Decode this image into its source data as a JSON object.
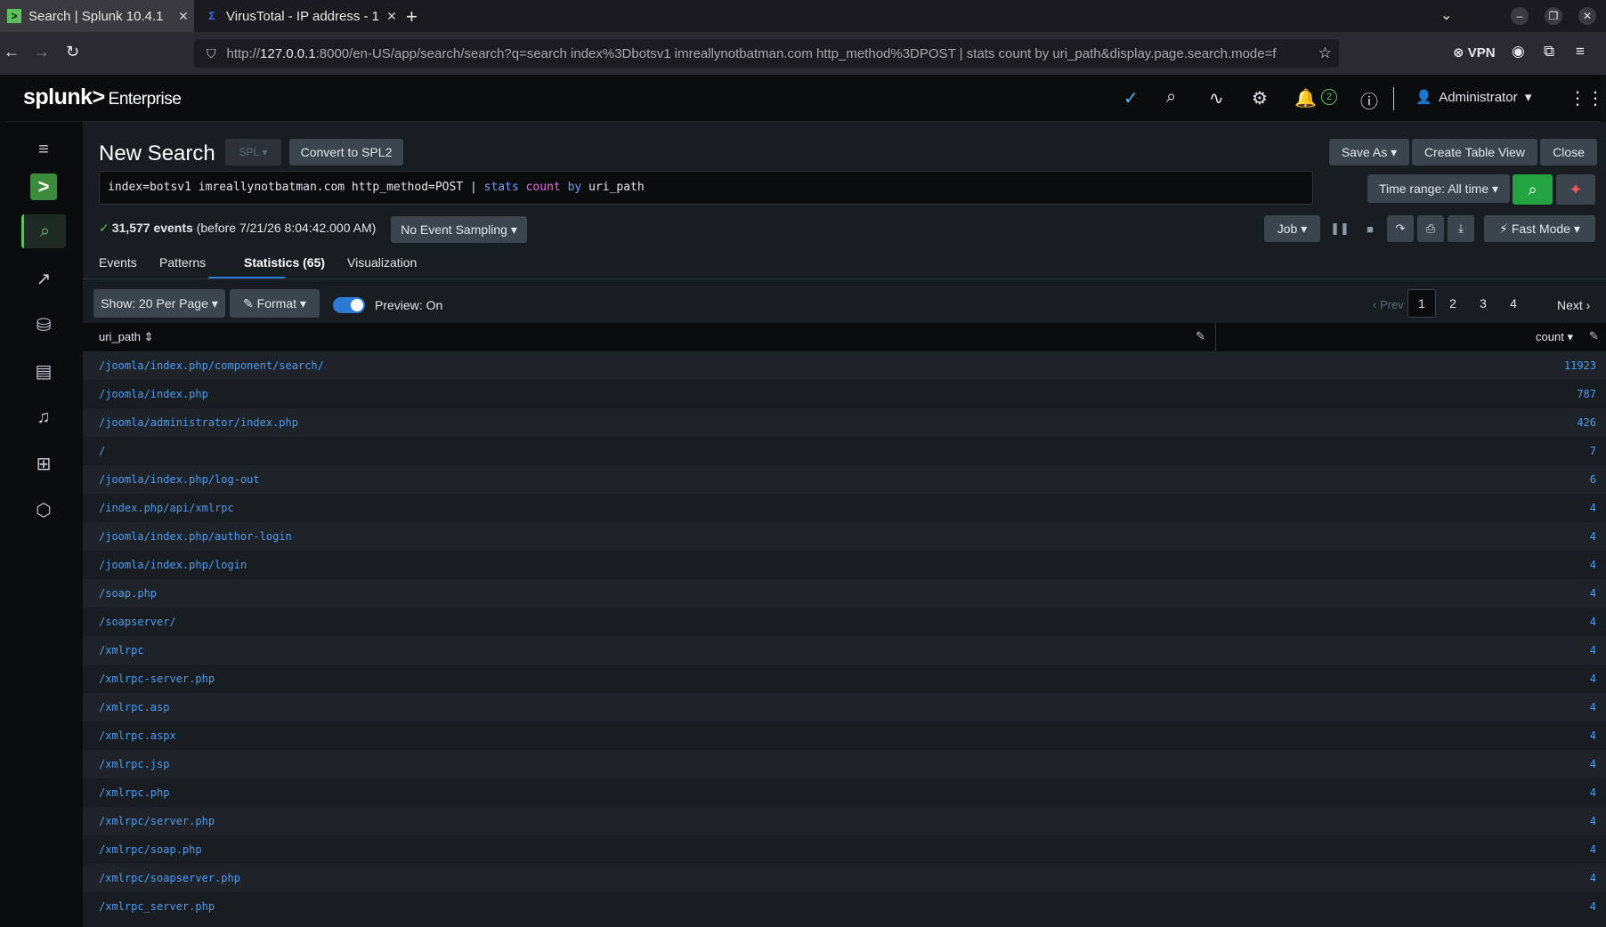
{
  "browser": {
    "tabs": [
      {
        "title": "Search | Splunk 10.4.1",
        "favicon": ">"
      },
      {
        "title": "VirusTotal - IP address - 1",
        "favicon": "Σ"
      }
    ],
    "url": {
      "prefix": "http://",
      "host": "127.0.0.1",
      "rest": ":8000/en-US/app/search/search?q=search index%3Dbotsv1 imreallynotbatman.com http_method%3DPOST | stats count by uri_path&display.page.search.mode=f"
    },
    "vpn_label": "VPN"
  },
  "splunk": {
    "logo": "splunk>",
    "product": "Enterprise",
    "notification_count": "2",
    "user": "Administrator"
  },
  "search": {
    "title": "New Search",
    "spl_label": "SPL",
    "convert_label": "Convert to SPL2",
    "save_as_label": "Save As",
    "create_table_view_label": "Create Table View",
    "close_label": "Close",
    "query_part1": "index=botsv1 imreallynotbatman.com http_method=POST | ",
    "query_cmd": "stats",
    "query_fn": "count",
    "query_by": "by",
    "query_field": "uri_path",
    "time_range_label": "Time range: All time",
    "event_count": "31,577 events",
    "event_suffix": "(before 7/21/26 8:04:42.000 AM)",
    "sampling_label": "No Event Sampling",
    "job_label": "Job",
    "mode_label": "Fast Mode"
  },
  "tabs": {
    "events": "Events",
    "patterns": "Patterns",
    "statistics": "Statistics (65)",
    "visualization": "Visualization"
  },
  "controls": {
    "per_page_label": "Show: 20 Per Page",
    "format_label": "Format",
    "preview_label": "Preview: On",
    "prev_label": "Prev",
    "next_label": "Next",
    "pages": [
      "1",
      "2",
      "3",
      "4"
    ],
    "current_page": "1"
  },
  "table": {
    "columns": [
      "uri_path",
      "count"
    ],
    "rows": [
      [
        "/joomla/index.php/component/search/",
        "11923"
      ],
      [
        "/joomla/index.php",
        "787"
      ],
      [
        "/joomla/administrator/index.php",
        "426"
      ],
      [
        "/",
        "7"
      ],
      [
        "/joomla/index.php/log-out",
        "6"
      ],
      [
        "/index.php/api/xmlrpc",
        "4"
      ],
      [
        "/joomla/index.php/author-login",
        "4"
      ],
      [
        "/joomla/index.php/login",
        "4"
      ],
      [
        "/soap.php",
        "4"
      ],
      [
        "/soapserver/",
        "4"
      ],
      [
        "/xmlrpc",
        "4"
      ],
      [
        "/xmlrpc-server.php",
        "4"
      ],
      [
        "/xmlrpc.asp",
        "4"
      ],
      [
        "/xmlrpc.aspx",
        "4"
      ],
      [
        "/xmlrpc.jsp",
        "4"
      ],
      [
        "/xmlrpc.php",
        "4"
      ],
      [
        "/xmlrpc/server.php",
        "4"
      ],
      [
        "/xmlrpc/soap.php",
        "4"
      ],
      [
        "/xmlrpc/soapserver.php",
        "4"
      ],
      [
        "/xmlrpc_server.php",
        "4"
      ]
    ]
  },
  "colors": {
    "accent_green": "#5cc05c",
    "link_blue": "#4f9bf0",
    "active_tab_blue": "#2c7ad6"
  }
}
